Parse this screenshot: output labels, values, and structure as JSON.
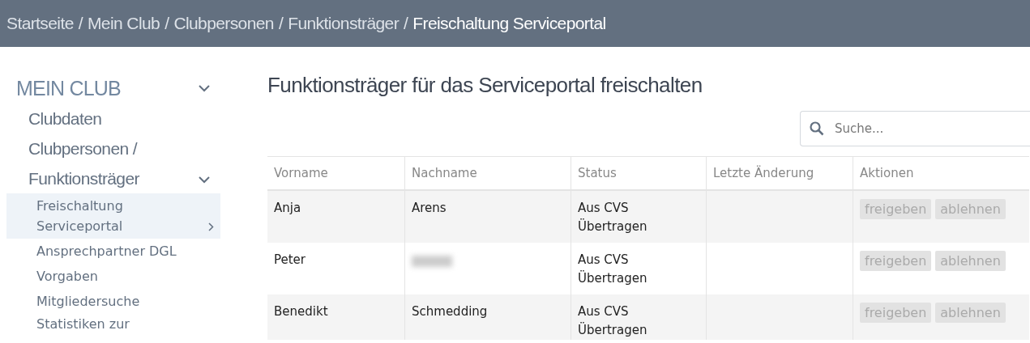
{
  "breadcrumb": [
    {
      "label": "Startseite",
      "current": false
    },
    {
      "separator": "/",
      "label": "Mein Club",
      "current": false
    },
    {
      "separator": "/",
      "label": "Clubpersonen",
      "current": false
    },
    {
      "separator": "/",
      "label": "Funktionsträger",
      "current": false
    },
    {
      "separator": "/",
      "label": "Freischaltung Serviceportal",
      "current": true
    }
  ],
  "sidebar": {
    "title": "MEIN CLUB",
    "expanded": true,
    "items": [
      {
        "label": "Clubdaten",
        "expanded": false
      },
      {
        "label": "Clubpersonen / Funktionsträger",
        "expanded": true,
        "children": [
          {
            "label": "Freischaltung Serviceportal",
            "selected": true
          },
          {
            "label": "Ansprechpartner DGL",
            "selected": false
          },
          {
            "label": "Vorgaben",
            "selected": false
          },
          {
            "label": "Mitgliedersuche",
            "selected": false
          },
          {
            "label": "Statistiken zur",
            "selected": false
          }
        ]
      }
    ]
  },
  "page_title": "Funktionsträger für das Serviceportal freischalten",
  "search": {
    "placeholder": "Suche..."
  },
  "table": {
    "columns": [
      "Vorname",
      "Nachname",
      "Status",
      "Letzte Änderung",
      "Aktionen"
    ],
    "rows": [
      {
        "first_name": "Anja",
        "last_name": "Arens",
        "last_name_redacted": false,
        "status": "Aus CVS Übertragen",
        "actions": [
          {
            "label": "freigeben",
            "disabled": true
          },
          {
            "label": "ablehnen",
            "disabled": true
          }
        ]
      },
      {
        "first_name": "Peter",
        "last_name_redacted": true,
        "status": "Aus CVS Übertragen",
        "actions": [
          {
            "label": "freigeben",
            "disabled": true
          },
          {
            "label": "ablehnen",
            "disabled": true
          }
        ]
      },
      {
        "first_name": "Benedikt",
        "last_name": "Schmedding",
        "last_name_redacted": false,
        "status": "Aus CVS Übertragen",
        "actions": [
          {
            "label": "freigeben",
            "disabled": true
          },
          {
            "label": "ablehnen",
            "disabled": true
          }
        ]
      }
    ]
  }
}
